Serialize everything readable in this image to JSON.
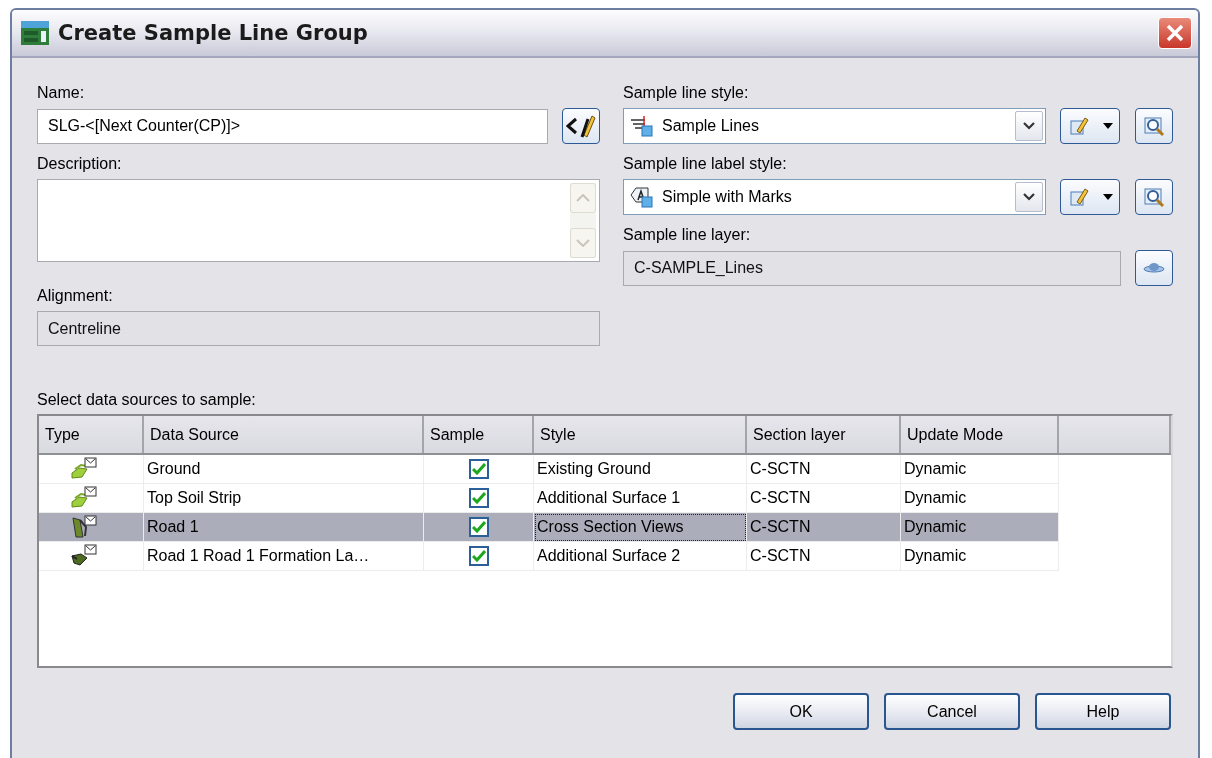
{
  "window": {
    "title": "Create Sample Line Group"
  },
  "name": {
    "label": "Name:",
    "value": "SLG-<[Next Counter(CP)]>"
  },
  "description": {
    "label": "Description:"
  },
  "alignment": {
    "label": "Alignment:",
    "value": "Centreline",
    "disabled": true
  },
  "sample_line_style": {
    "label": "Sample line style:",
    "value": "Sample Lines",
    "kind": "line"
  },
  "sample_line_label_style": {
    "label": "Sample line label style:",
    "value": "Simple with Marks",
    "kind": "label"
  },
  "sample_line_layer": {
    "label": "Sample line layer:",
    "value": "C-SAMPLE_Lines",
    "disabled": true
  },
  "data_sources": {
    "label": "Select data sources to sample:",
    "columns": [
      "Type",
      "Data Source",
      "Sample",
      "Style",
      "Section layer",
      "Update Mode"
    ],
    "rows": [
      {
        "kind": "surface",
        "data_source": "Ground",
        "sample": true,
        "style": "Existing Ground",
        "section_layer": "C-SCTN",
        "update_mode": "Dynamic",
        "selected": false
      },
      {
        "kind": "surface",
        "data_source": "Top Soil Strip",
        "sample": true,
        "style": "Additional Surface 1",
        "section_layer": "C-SCTN",
        "update_mode": "Dynamic",
        "selected": false
      },
      {
        "kind": "corridor",
        "data_source": "Road 1",
        "sample": true,
        "style": "Cross Section Views",
        "section_layer": "C-SCTN",
        "update_mode": "Dynamic",
        "selected": true
      },
      {
        "kind": "corridor_surface",
        "data_source": "Road 1 Road 1 Formation La…",
        "sample": true,
        "style": "Additional Surface 2",
        "section_layer": "C-SCTN",
        "update_mode": "Dynamic",
        "selected": false
      }
    ]
  },
  "buttons": [
    "OK",
    "Cancel",
    "Help"
  ]
}
